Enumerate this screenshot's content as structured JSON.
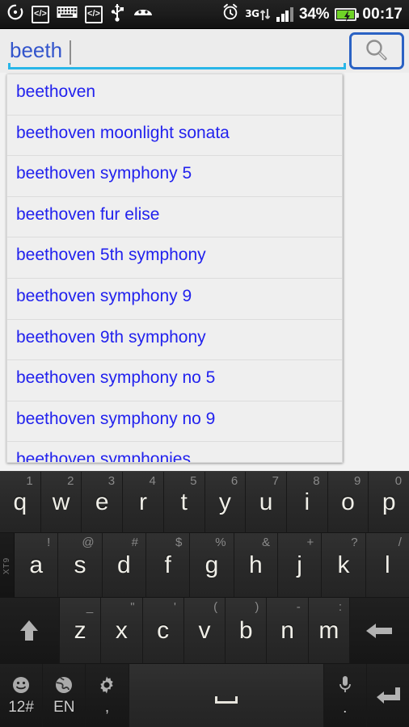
{
  "status_bar": {
    "left_icons": [
      {
        "name": "rotation-lock-icon",
        "glyph": "◔"
      },
      {
        "name": "developer-code-icon",
        "label": "</>"
      },
      {
        "name": "keyboard-icon",
        "glyph": "⌨"
      },
      {
        "name": "developer-code-icon-2",
        "label": "</>"
      },
      {
        "name": "usb-icon",
        "glyph": "⚯"
      },
      {
        "name": "cyanogenmod-icon",
        "glyph": "◖"
      }
    ],
    "alarm_icon": "alarm-clock-icon",
    "network_type": "3G",
    "signal_bars_filled": 3,
    "signal_bars_total": 4,
    "battery_percent": "34%",
    "battery_charging": true,
    "clock": "00:17"
  },
  "search": {
    "value": "beeth",
    "placeholder": "",
    "button_label": "search-button",
    "text_color": "#3355cc",
    "underline_color": "#29b6e8",
    "button_border_color": "#2a62c4"
  },
  "suggestions": [
    "beethoven",
    "beethoven moonlight sonata",
    "beethoven symphony 5",
    "beethoven fur elise",
    "beethoven 5th symphony",
    "beethoven symphony 9",
    "beethoven 9th symphony",
    "beethoven symphony no 5",
    "beethoven symphony no 9",
    "beethoven symphonies"
  ],
  "keyboard": {
    "mode_label": "XT9",
    "row1": [
      {
        "key": "q",
        "hint": "1"
      },
      {
        "key": "w",
        "hint": "2"
      },
      {
        "key": "e",
        "hint": "3"
      },
      {
        "key": "r",
        "hint": "4"
      },
      {
        "key": "t",
        "hint": "5"
      },
      {
        "key": "y",
        "hint": "6"
      },
      {
        "key": "u",
        "hint": "7"
      },
      {
        "key": "i",
        "hint": "8"
      },
      {
        "key": "o",
        "hint": "9"
      },
      {
        "key": "p",
        "hint": "0"
      }
    ],
    "row2": [
      {
        "key": "a",
        "hint": "!"
      },
      {
        "key": "s",
        "hint": "@"
      },
      {
        "key": "d",
        "hint": "#"
      },
      {
        "key": "f",
        "hint": "$"
      },
      {
        "key": "g",
        "hint": "%"
      },
      {
        "key": "h",
        "hint": "&"
      },
      {
        "key": "j",
        "hint": "+"
      },
      {
        "key": "k",
        "hint": "?"
      },
      {
        "key": "l",
        "hint": "/"
      }
    ],
    "row3": [
      {
        "key": "z",
        "hint": "_"
      },
      {
        "key": "x",
        "hint": "\""
      },
      {
        "key": "c",
        "hint": "'"
      },
      {
        "key": "v",
        "hint": "("
      },
      {
        "key": "b",
        "hint": ")"
      },
      {
        "key": "n",
        "hint": "-"
      },
      {
        "key": "m",
        "hint": ":"
      }
    ],
    "shift_label": "shift-key",
    "backspace_label": "backspace-key",
    "row4": {
      "emoji_sub": "12#",
      "language_sub": "EN",
      "settings_sub": ",",
      "space": "",
      "mic_sub": ".",
      "enter": "enter-key"
    }
  }
}
